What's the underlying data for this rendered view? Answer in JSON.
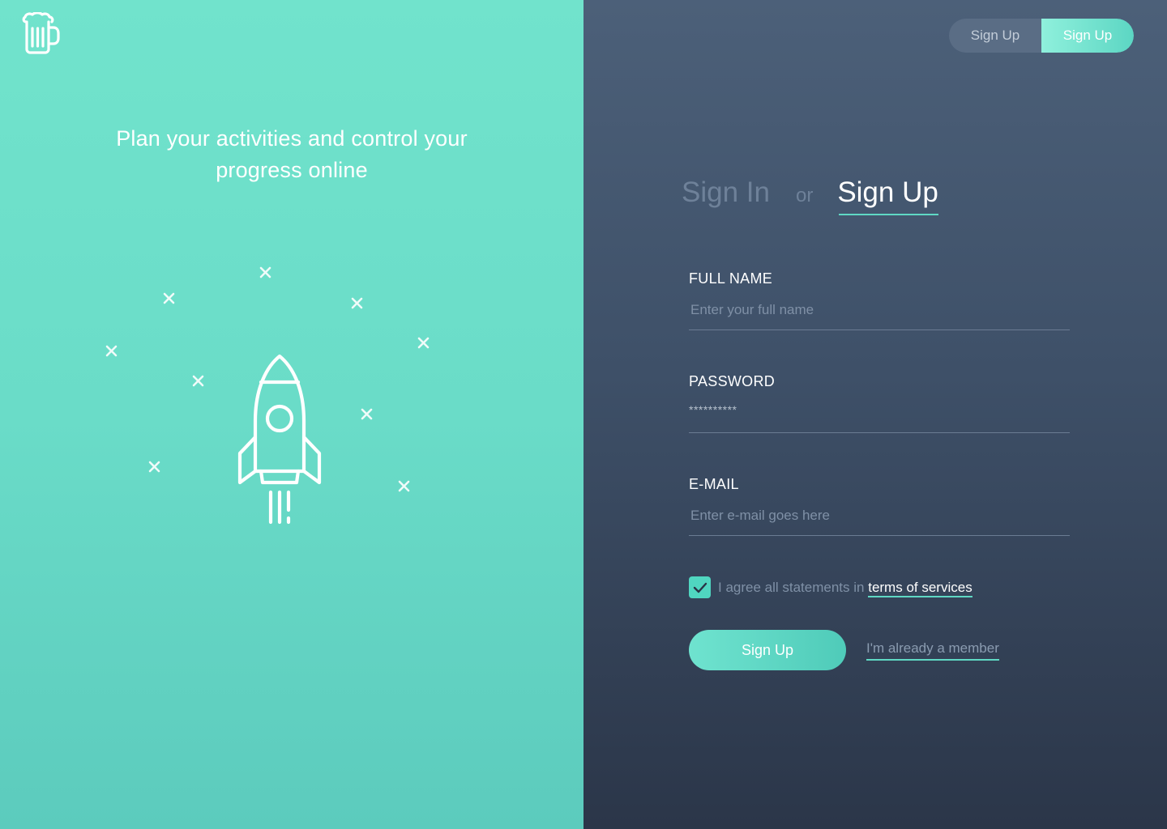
{
  "left": {
    "tagline": "Plan your activities and control your progress online",
    "logo_icon": "beer-mug-icon",
    "illustration_icon": "rocket-icon",
    "star_icon": "cross-star-icon"
  },
  "right": {
    "toggle": {
      "left_label": "Sign Up",
      "right_label": "Sign Up"
    },
    "tabs": {
      "sign_in": "Sign In",
      "or": "or",
      "sign_up": "Sign Up"
    },
    "form": {
      "full_name_label": "FULL NAME",
      "full_name_placeholder": "Enter your full name",
      "password_label": "PASSWORD",
      "password_value": "**********",
      "email_label": "E-MAIL",
      "email_placeholder": "Enter e-mail goes here",
      "agree_prefix": "I agree all statements in ",
      "agree_link": "terms of services",
      "agree_checked": true,
      "submit_label": "Sign Up",
      "member_link": "I'm already a member"
    }
  },
  "colors": {
    "accent": "#5fd8c4",
    "left_bg": "#6adcc8",
    "right_bg": "#3e5068"
  }
}
